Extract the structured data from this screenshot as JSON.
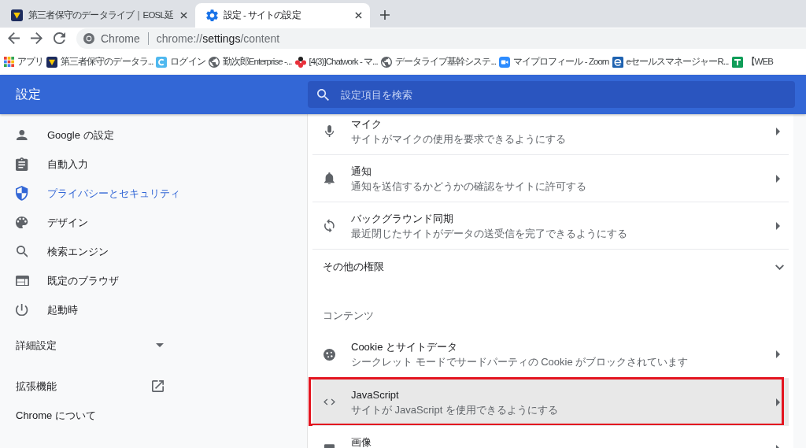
{
  "tabs": [
    {
      "title": "第三者保守のデータライブ｜EOSL延",
      "selected": false
    },
    {
      "title": "設定 - サイトの設定",
      "selected": true
    }
  ],
  "address_bar": {
    "chip": "Chrome",
    "url": "chrome://**settings**/content"
  },
  "bookmarks": [
    {
      "label": "アプリ"
    },
    {
      "label": "第三者保守のデータラ..."
    },
    {
      "label": "ログイン"
    },
    {
      "label": "勤次郎Enterprise -..."
    },
    {
      "label": "[4(3)]Chatwork - マ..."
    },
    {
      "label": "データライブ基幹システ..."
    },
    {
      "label": "マイプロフィール - Zoom"
    },
    {
      "label": "eセールスマネージャーR..."
    },
    {
      "label": "【WEB"
    }
  ],
  "header": {
    "title": "設定",
    "search": {
      "placeholder": "設定項目を検索"
    }
  },
  "sidebar": {
    "items": [
      {
        "label": "Google の設定",
        "selected": false
      },
      {
        "label": "自動入力",
        "selected": false
      },
      {
        "label": "プライバシーとセキュリティ",
        "selected": true
      },
      {
        "label": "デザイン",
        "selected": false
      },
      {
        "label": "検索エンジン",
        "selected": false
      },
      {
        "label": "既定のブラウザ",
        "selected": false
      },
      {
        "label": "起動時",
        "selected": false
      }
    ],
    "advanced": {
      "label": "詳細設定",
      "expanded": false
    },
    "extensions": {
      "label": "拡張機能"
    },
    "about": {
      "label": "Chrome について"
    }
  },
  "permissions": {
    "rows": [
      {
        "title": "マイク",
        "subtitle": "サイトがマイクの使用を要求できるようにする",
        "selected": false,
        "outlined": false
      },
      {
        "title": "通知",
        "subtitle": "通知を送信するかどうかの確認をサイトに許可する",
        "selected": false,
        "outlined": false
      },
      {
        "title": "バックグラウンド同期",
        "subtitle": "最近閉じたサイトがデータの送受信を完了できるようにする",
        "selected": false,
        "outlined": false
      }
    ],
    "more": {
      "label": "その他の権限",
      "expanded": false
    }
  },
  "content": {
    "heading": "コンテンツ",
    "rows": [
      {
        "title": "Cookie とサイトデータ",
        "subtitle": "シークレット モードでサードパーティの Cookie がブロックされています",
        "selected": false,
        "outlined": false
      },
      {
        "title": "JavaScript",
        "subtitle": "サイトが JavaScript を使用できるようにする",
        "selected": true,
        "outlined": true
      },
      {
        "title": "画像",
        "selected": false,
        "outlined": false
      }
    ]
  }
}
